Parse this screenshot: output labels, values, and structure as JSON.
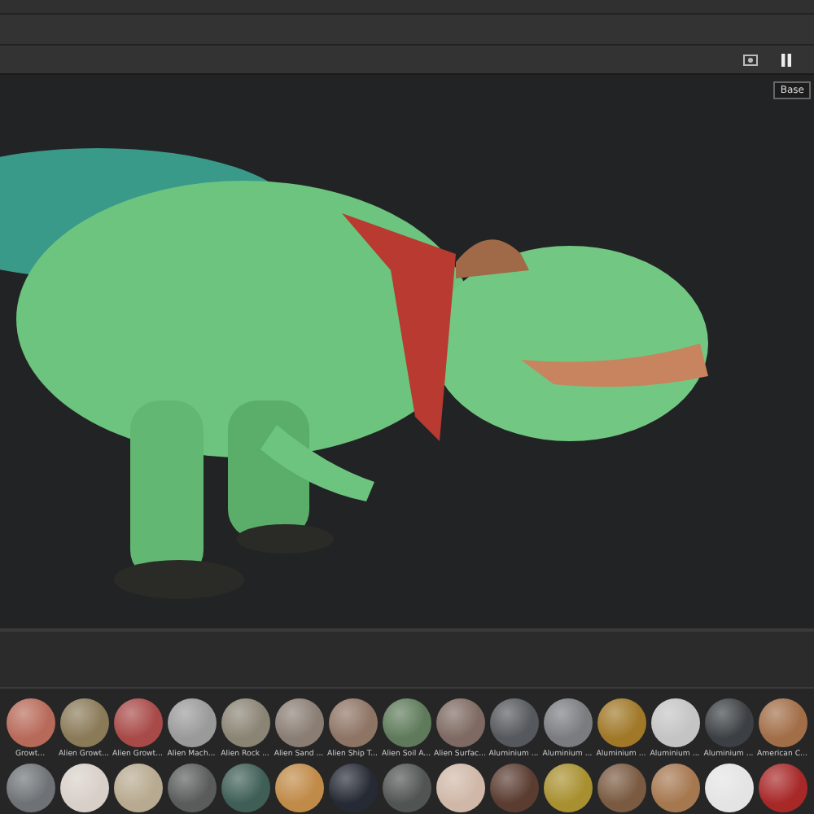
{
  "viewport": {
    "kind": "picture",
    "tooltip": "Base"
  },
  "shelf": {
    "rows": [
      {
        "materials": [
          {
            "name": "Growt...",
            "color": "#b86a5a"
          },
          {
            "name": "Alien Growt...",
            "color": "#8a7a58"
          },
          {
            "name": "Alien Growt...",
            "color": "#a84a48"
          },
          {
            "name": "Alien Mach...",
            "color": "#9a9a9a"
          },
          {
            "name": "Alien Rock ...",
            "color": "#8a8474"
          },
          {
            "name": "Alien Sand ...",
            "color": "#8a7e74"
          },
          {
            "name": "Alien Ship T...",
            "color": "#8e7464"
          },
          {
            "name": "Alien Soil A...",
            "color": "#5e7a5a"
          },
          {
            "name": "Alien Surfac...",
            "color": "#7e6a62"
          },
          {
            "name": "Aluminium ...",
            "color": "#55585c"
          },
          {
            "name": "Aluminium ...",
            "color": "#7a7c80"
          },
          {
            "name": "Aluminium ...",
            "color": "#a07828"
          },
          {
            "name": "Aluminium ...",
            "color": "#c4c4c4"
          },
          {
            "name": "Aluminium ...",
            "color": "#3c4044"
          },
          {
            "name": "American C...",
            "color": "#a26e48"
          }
        ]
      },
      {
        "materials": [
          {
            "color": "#6e7276"
          },
          {
            "color": "#d8d0c8"
          },
          {
            "color": "#b8aa90"
          },
          {
            "color": "#5a5c5c"
          },
          {
            "color": "#3e5e56"
          },
          {
            "color": "#c08a48"
          },
          {
            "color": "#262a34"
          },
          {
            "color": "#505452"
          },
          {
            "color": "#d0b8a8"
          },
          {
            "color": "#5a3c30"
          },
          {
            "color": "#a89030"
          },
          {
            "color": "#7a5a40"
          },
          {
            "color": "#a67850"
          },
          {
            "color": "#e4e4e4"
          },
          {
            "color": "#a82828"
          }
        ]
      }
    ]
  }
}
